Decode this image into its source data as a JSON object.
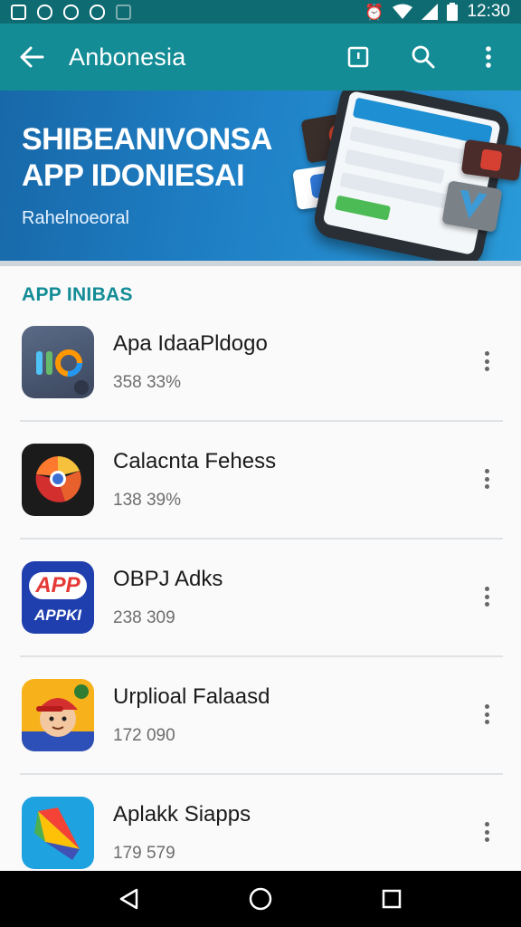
{
  "status_bar": {
    "time": "12:30",
    "icons": [
      "image-icon",
      "notification-icon",
      "shield-icon",
      "shield-check-icon",
      "upload-icon",
      "alarm-icon",
      "wifi-icon",
      "signal-icon",
      "battery-icon"
    ]
  },
  "app_bar": {
    "title": "Anbonesia",
    "actions": [
      "back-arrow-icon",
      "feedback-icon",
      "search-icon",
      "more-vert-icon"
    ]
  },
  "banner": {
    "title_line1": "SHIBEANIVONSA",
    "title_line2": "APP IDONIESAI",
    "subtitle": "Rahelnoeoral"
  },
  "section": {
    "header": "APP INIBAS"
  },
  "apps": [
    {
      "name": "Apa IdaaPldogo",
      "count": "358 33%",
      "icon": "app-icon-ie"
    },
    {
      "name": "Calacnta Fehess",
      "count": "138 39%",
      "icon": "app-icon-chrome-like"
    },
    {
      "name": "OBPJ Adks",
      "count": "238 309",
      "icon": "app-icon-app-badge"
    },
    {
      "name": "Urplioal Falaasd",
      "count": "172 090",
      "icon": "app-icon-character"
    },
    {
      "name": "Aplakk Siapps",
      "count": "179 579",
      "icon": "app-icon-kite"
    }
  ],
  "icon_texts": {
    "app3_top": "APP",
    "app3_bottom": "APPKI"
  },
  "nav_bar": {
    "buttons": [
      "back-triangle-icon",
      "home-circle-icon",
      "recents-square-icon"
    ]
  },
  "colors": {
    "status_bar": "#0f6b72",
    "app_bar": "#138c96",
    "accent": "#138c96",
    "banner": "#1f80c6"
  }
}
